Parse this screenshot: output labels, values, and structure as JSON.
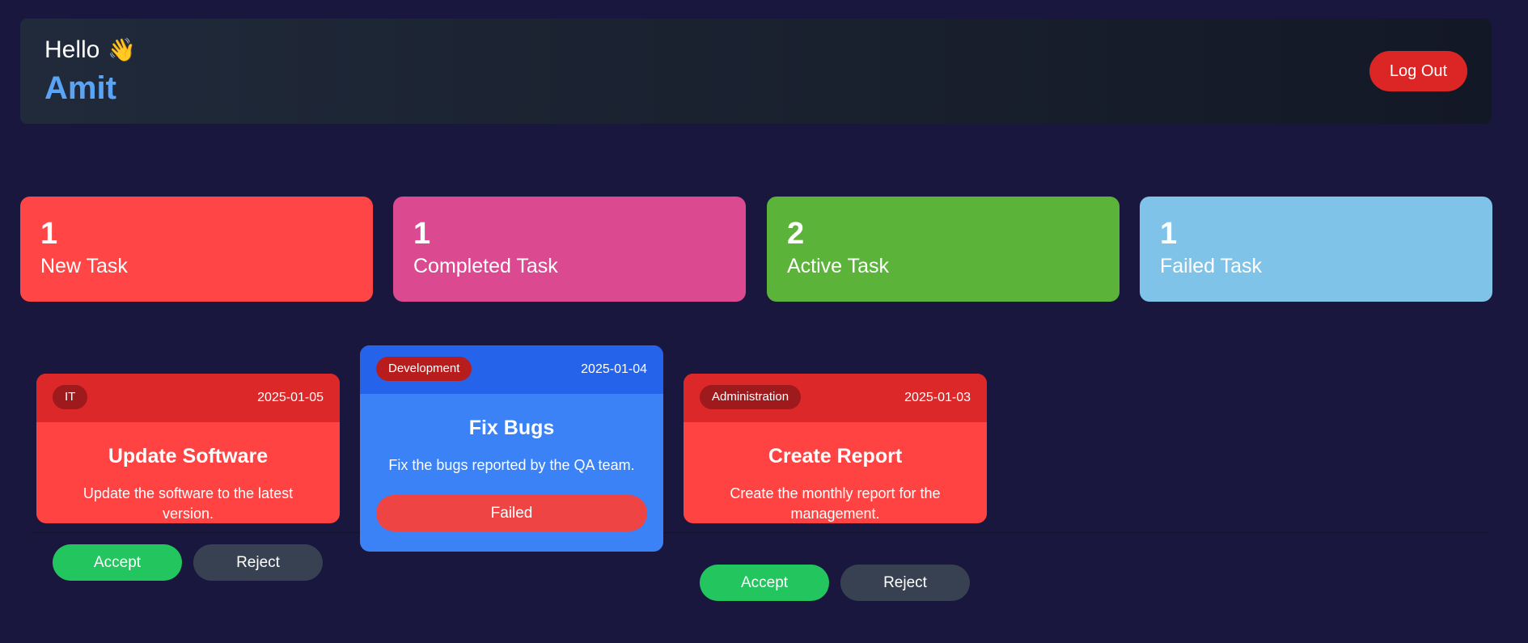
{
  "header": {
    "greeting": "Hello",
    "wave_emoji": "👋",
    "user_name": "Amit",
    "logout_label": "Log Out"
  },
  "stats": [
    {
      "count": "1",
      "label": "New Task",
      "color": "#ff4545"
    },
    {
      "count": "1",
      "label": "Completed Task",
      "color": "#db4990"
    },
    {
      "count": "2",
      "label": "Active Task",
      "color": "#5bb33a"
    },
    {
      "count": "1",
      "label": "Failed Task",
      "color": "#80c3e8"
    }
  ],
  "tasks": [
    {
      "category": "IT",
      "date": "2025-01-05",
      "title": "Update Software",
      "description": "Update the software to the latest version.",
      "accept_label": "Accept",
      "reject_label": "Reject"
    },
    {
      "category": "Development",
      "date": "2025-01-04",
      "title": "Fix Bugs",
      "description": "Fix the bugs reported by the QA team.",
      "status_label": "Failed"
    },
    {
      "category": "Administration",
      "date": "2025-01-03",
      "title": "Create Report",
      "description": "Create the monthly report for the management.",
      "accept_label": "Accept",
      "reject_label": "Reject"
    }
  ],
  "colors": {
    "background": "#19173d",
    "accent_name": "#5ba4f5",
    "logout": "#dc2626",
    "accept": "#22c55e",
    "reject": "#374151"
  }
}
